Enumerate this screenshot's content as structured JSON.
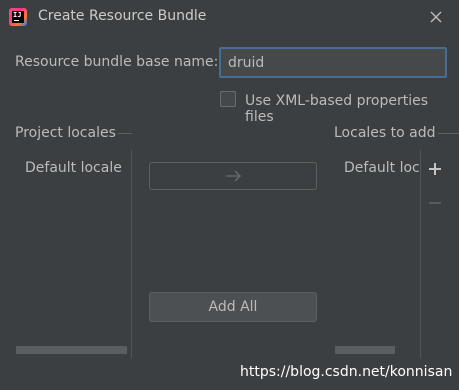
{
  "window": {
    "title": "Create Resource Bundle",
    "app_icon_text": "IJ"
  },
  "form": {
    "base_name_label": "Resource bundle base name:",
    "base_name_value": "druid",
    "xml_checkbox_label": "Use XML-based properties files",
    "xml_checkbox_checked": false
  },
  "project_locales": {
    "header": "Project locales",
    "items": [
      "Default locale"
    ]
  },
  "locales_to_add": {
    "header": "Locales to add",
    "items": [
      "Default locale"
    ]
  },
  "buttons": {
    "add_all": "Add All"
  },
  "icons": {
    "close": "close-icon",
    "move_right": "arrow-right-icon",
    "add": "plus-icon",
    "remove": "minus-icon"
  },
  "watermark": "https://blog.csdn.net/konnisan",
  "colors": {
    "background": "#3c3f41",
    "input_border_focus": "#466d94",
    "text": "#bbbbbb"
  }
}
